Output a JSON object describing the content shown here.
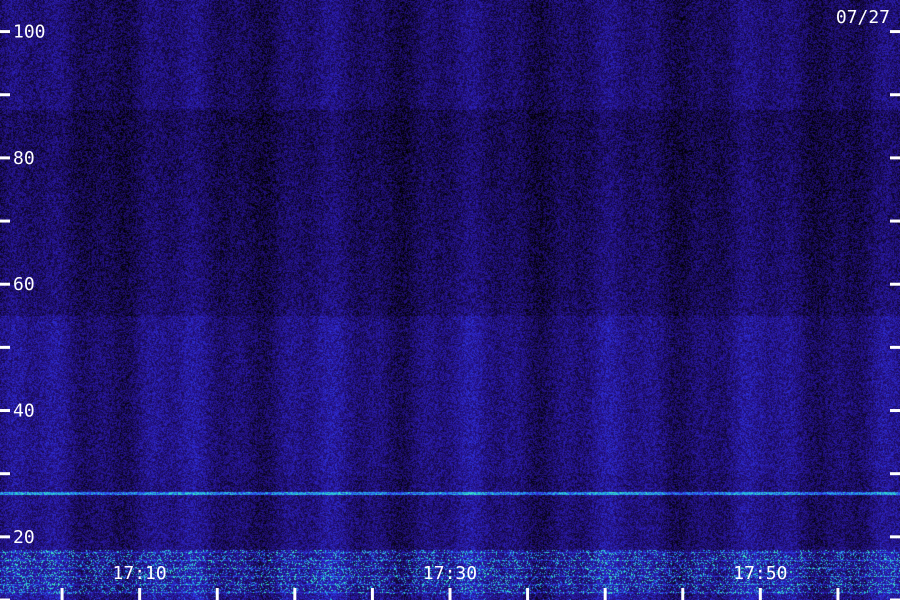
{
  "chart_data": {
    "type": "heatmap",
    "date_label": "07/27",
    "y_axis": {
      "range": [
        10,
        105
      ],
      "major_ticks": [
        20,
        40,
        60,
        80,
        100
      ],
      "minor_ticks": [
        10,
        30,
        50,
        70,
        90
      ],
      "tick_labels": [
        "20",
        "40",
        "60",
        "80",
        "100"
      ]
    },
    "x_axis": {
      "range": [
        "17:01",
        "17:59"
      ],
      "labeled_ticks": [
        "17:10",
        "17:30",
        "17:50"
      ],
      "tick_label_text": [
        "17:10",
        "17:30",
        "17:50"
      ],
      "minor_step_minutes": 5
    },
    "colormap": [
      "#000000",
      "#1a0b5a",
      "#2a1aa8",
      "#2f3cf0",
      "#20a8e8",
      "#40f0c0"
    ],
    "features": {
      "narrowband_line_level": 27,
      "strong_band_range": [
        11,
        18
      ],
      "enhanced_region_range": [
        30,
        55
      ]
    }
  }
}
